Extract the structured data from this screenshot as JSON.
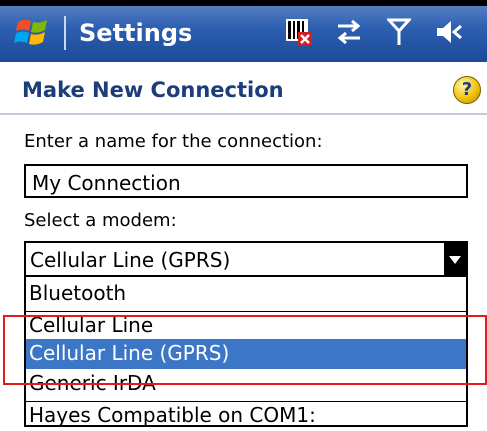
{
  "titlebar": {
    "title": "Settings"
  },
  "header": {
    "title": "Make New Connection",
    "help_symbol": "?"
  },
  "form": {
    "name_label": "Enter a name for the connection:",
    "name_value": "My Connection",
    "modem_label": "Select a modem:",
    "modem_selected": "Cellular Line (GPRS)",
    "modem_options": [
      "Bluetooth",
      "Cellular Line",
      "Cellular Line (GPRS)",
      "Generic IrDA",
      "Hayes Compatible on COM1:"
    ]
  },
  "colors": {
    "titlebar": "#2d5fb0",
    "header_text": "#1d3d7a",
    "highlight": "#3c77c7",
    "annotation": "#e21b1b"
  }
}
